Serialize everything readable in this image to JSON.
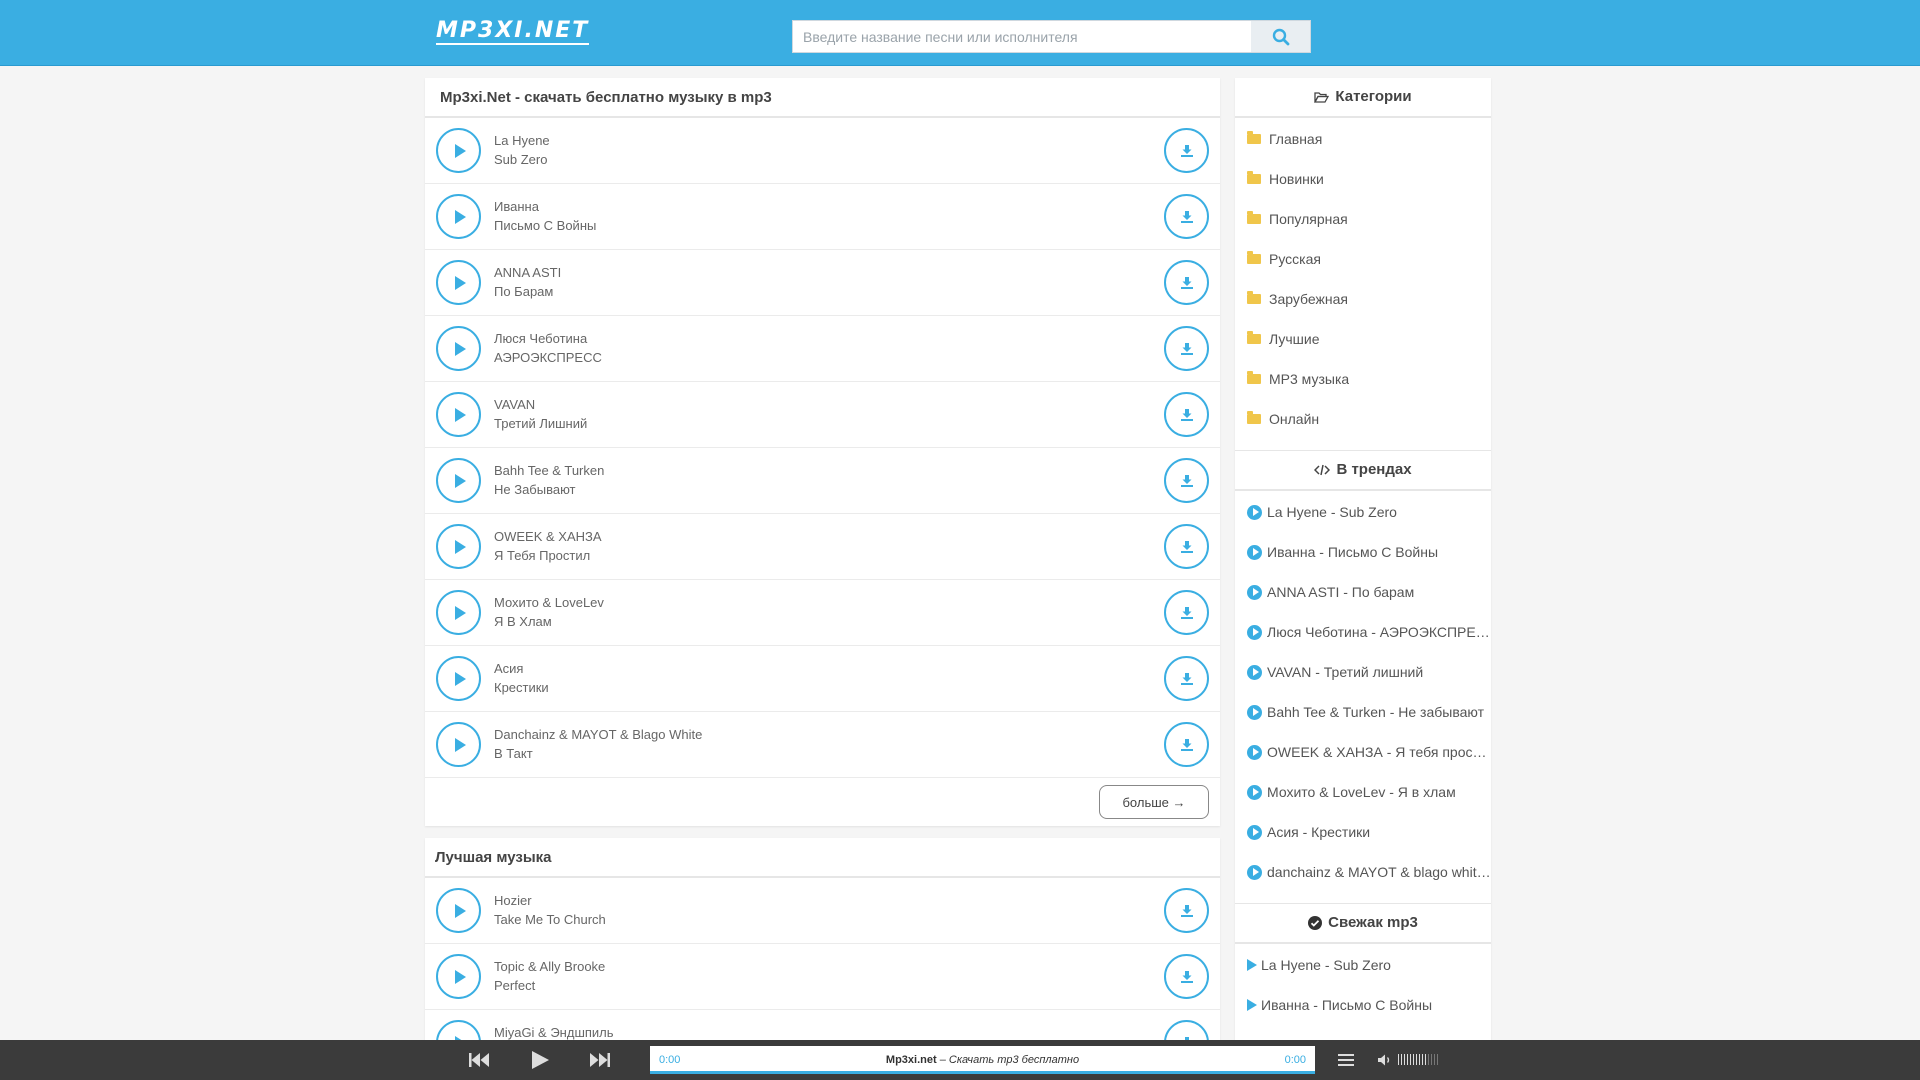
{
  "header": {
    "logo": "MP3XI.NET",
    "search_placeholder": "Введите название песни или исполнителя"
  },
  "main": {
    "title": "Mp3xi.Net - скачать бесплатно музыку в mp3",
    "tracks": [
      {
        "artist": "La Hyene",
        "song": "Sub Zero"
      },
      {
        "artist": "Иванна",
        "song": "Письмо С Войны"
      },
      {
        "artist": "ANNA ASTI",
        "song": "По Барам"
      },
      {
        "artist": "Люся Чеботина",
        "song": "АЭРОЭКСПРЕСС"
      },
      {
        "artist": "VAVAN",
        "song": "Третий Лишний"
      },
      {
        "artist": "Bahh Tee & Turken",
        "song": "Не Забывают"
      },
      {
        "artist": "OWEEK & ХАНЗА",
        "song": "Я Тебя Простил"
      },
      {
        "artist": "Мохито & LoveLev",
        "song": "Я В Хлам"
      },
      {
        "artist": "Асия",
        "song": "Крестики"
      },
      {
        "artist": "Danchainz & MAYOT & Blago White",
        "song": "В Такт"
      }
    ],
    "more_label": "больше →"
  },
  "best": {
    "title": "Лучшая музыка",
    "tracks": [
      {
        "artist": "Hozier",
        "song": "Take Me To Church"
      },
      {
        "artist": "Topic & Ally Brooke",
        "song": "Perfect"
      },
      {
        "artist": "MiyaGi & Эндшпиль",
        "song": ""
      }
    ]
  },
  "sidebar": {
    "categories_title": "Категории",
    "categories": [
      "Главная",
      "Новинки",
      "Популярная",
      "Русская",
      "Зарубежная",
      "Лучшие",
      "МР3 музыка",
      "Онлайн"
    ],
    "trends_title": "В трендах",
    "trends": [
      "La Hyene - Sub Zero",
      "Иванна - Письмо С Войны",
      "ANNA ASTI - По барам",
      "Люся Чеботина - АЭРОЭКСПРЕСС",
      "VAVAN - Третий лишний",
      "Bahh Tee & Turken - Не забывают",
      "OWEEK & ХАНЗА - Я тебя простил",
      "Мохито & LoveLev - Я в хлам",
      "Асия - Крестики",
      "danchainz & MAYOT & blago white - В такт"
    ],
    "fresh_title": "Свежак mp3",
    "fresh": [
      "La Hyene - Sub Zero",
      "Иванна - Письмо С Войны"
    ]
  },
  "player": {
    "time_current": "0:00",
    "time_total": "0:00",
    "site": "Mp3xi.net",
    "separator": " – ",
    "tagline": "Скачать mp3 бесплатно"
  },
  "colors": {
    "accent": "#3aaee2",
    "folder": "#f0c64a",
    "player_bg": "#3b3b3b"
  }
}
